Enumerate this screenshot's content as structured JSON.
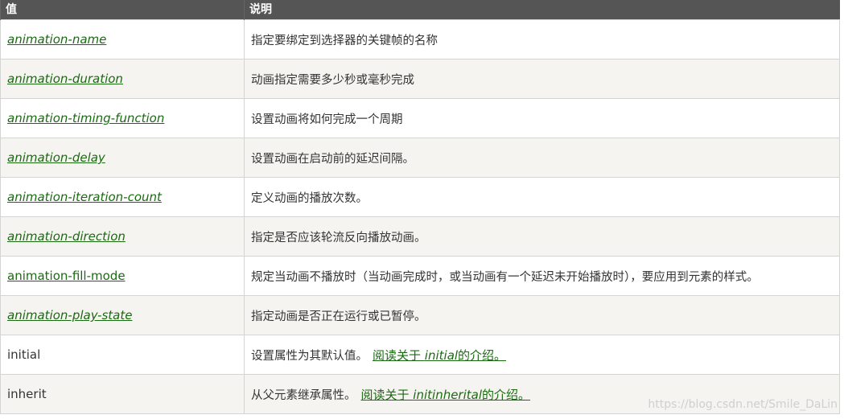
{
  "header": {
    "col_value": "值",
    "col_desc": "说明"
  },
  "rows": [
    {
      "value": "animation-name",
      "desc": "指定要绑定到选择器的关键帧的名称"
    },
    {
      "value": "animation-duration",
      "desc": "动画指定需要多少秒或毫秒完成"
    },
    {
      "value": "animation-timing-function",
      "desc": "设置动画将如何完成一个周期"
    },
    {
      "value": "animation-delay",
      "desc": "设置动画在启动前的延迟间隔。"
    },
    {
      "value": "animation-iteration-count",
      "desc": "定义动画的播放次数。"
    },
    {
      "value": "animation-direction",
      "desc": "指定是否应该轮流反向播放动画。"
    },
    {
      "value": "animation-fill-mode",
      "desc": "规定当动画不播放时（当动画完成时，或当动画有一个延迟未开始播放时），要应用到元素的样式。"
    },
    {
      "value": "animation-play-state",
      "desc": "指定动画是否正在运行或已暂停。"
    },
    {
      "value": "initial",
      "desc": "设置属性为其默认值。",
      "link_prefix": "阅读关于",
      "link_code": "initial",
      "link_suffix": "的介绍。"
    },
    {
      "value": "inherit",
      "desc": "从父元素继承属性。",
      "link_prefix": "阅读关于",
      "link_code": "initinherital",
      "link_suffix": "的介绍。"
    }
  ],
  "watermark": "https://blog.csdn.net/Smile_DaLin",
  "colors": {
    "header_bg": "#555555",
    "link": "#1a6a12",
    "alt_row": "#f6f4f0"
  }
}
